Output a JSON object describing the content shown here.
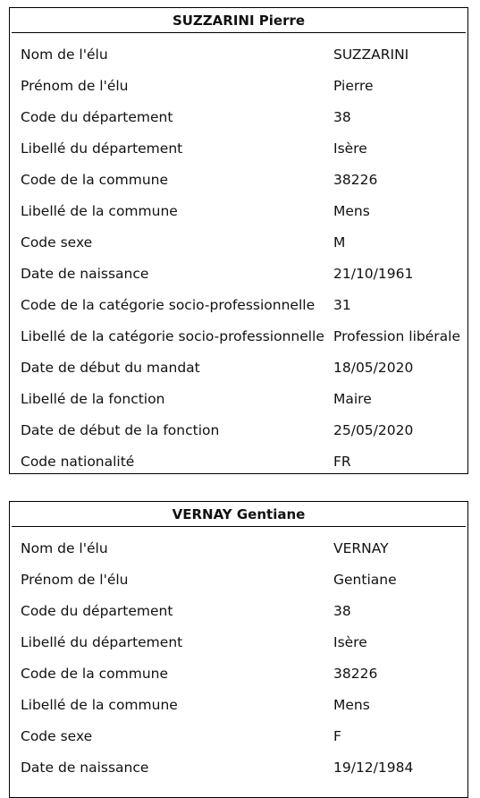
{
  "records": [
    {
      "title": "SUZZARINI Pierre",
      "rows": [
        {
          "label": "Nom de l'élu",
          "value": "SUZZARINI"
        },
        {
          "label": "Prénom de l'élu",
          "value": "Pierre"
        },
        {
          "label": "Code du département",
          "value": "38"
        },
        {
          "label": "Libellé du département",
          "value": "Isère"
        },
        {
          "label": "Code de la commune",
          "value": "38226"
        },
        {
          "label": "Libellé de la commune",
          "value": "Mens"
        },
        {
          "label": "Code sexe",
          "value": "M"
        },
        {
          "label": "Date de naissance",
          "value": "21/10/1961"
        },
        {
          "label": "Code de la catégorie socio-professionnelle",
          "value": "31"
        },
        {
          "label": "Libellé de la catégorie socio-professionnelle",
          "value": "Profession libérale"
        },
        {
          "label": "Date de début du mandat",
          "value": "18/05/2020"
        },
        {
          "label": "Libellé de la fonction",
          "value": "Maire"
        },
        {
          "label": "Date de début de la fonction",
          "value": "25/05/2020"
        },
        {
          "label": "Code nationalité",
          "value": "FR"
        }
      ]
    },
    {
      "title": "VERNAY Gentiane",
      "rows": [
        {
          "label": "Nom de l'élu",
          "value": "VERNAY"
        },
        {
          "label": "Prénom de l'élu",
          "value": "Gentiane"
        },
        {
          "label": "Code du département",
          "value": "38"
        },
        {
          "label": "Libellé du département",
          "value": "Isère"
        },
        {
          "label": "Code de la commune",
          "value": "38226"
        },
        {
          "label": "Libellé de la commune",
          "value": "Mens"
        },
        {
          "label": "Code sexe",
          "value": "F"
        },
        {
          "label": "Date de naissance",
          "value": "19/12/1984"
        }
      ]
    }
  ]
}
